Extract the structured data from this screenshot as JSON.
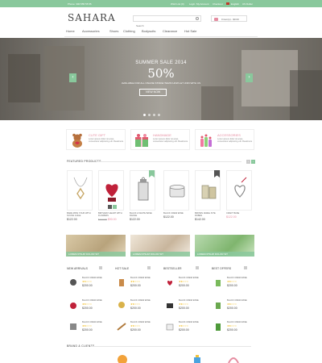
{
  "topbar": {
    "phone": "Phone: 300 555 55 55",
    "links": [
      "Wish List (0)",
      "Login",
      "My Account",
      "Checkout",
      "English",
      "US Dollar"
    ]
  },
  "header": {
    "logo": "SAHARA",
    "search_placeholder": "Search",
    "cart_label": "0 item(s) - $0.00"
  },
  "nav": [
    "Home",
    "Accessories",
    "Shoes",
    "Clothing",
    "Bodysuits",
    "Clearance",
    "Hot Sale"
  ],
  "hero": {
    "title": "SUMMER SALE 2014",
    "percent": "50%",
    "subtitle": "AVAILABLE FOR ALL ONLINE STORE ITEMS! HOW LET JOIN WITH US",
    "button": "VIEW NOW",
    "prev": "‹",
    "next": "›"
  },
  "features": [
    {
      "title": "CUTE GIFT",
      "desc": "Lorem ipsum dolor sit amet, consectetur adipiscing elit. Readmore",
      "color": "#e58ca0"
    },
    {
      "title": "HANDMADE",
      "desc": "Lorem ipsum dolor sit amet, consectetur adipiscing elit. Readmore",
      "color": "#e58ca0"
    },
    {
      "title": "ACCESSORIES",
      "desc": "Lorem ipsum dolor sit amet, consectetur adipiscing elit. Readmore",
      "color": "#e58ca0"
    }
  ],
  "featured": {
    "title": "FEATURED PRODUCTS",
    "products": [
      {
        "name": "BARE MISS YOUR WITH SOUVE JAIGE",
        "price": "$122.00",
        "old": ""
      },
      {
        "name": "BIRTHDAY HEART WITH FLOWERS",
        "price": "$90.00",
        "old": "$122.00"
      },
      {
        "name": "BLACK & WHITE BASE RANGE",
        "price": "$122.00",
        "old": ""
      },
      {
        "name": "BLACK CREW ESSE",
        "price": "$122.00",
        "old": ""
      },
      {
        "name": "BROWN JEWEL SITE ROBES",
        "price": "$142.00",
        "old": ""
      },
      {
        "name": "CRAFT BASE",
        "price": "$122.00",
        "old": ""
      }
    ]
  },
  "banners": [
    "LOREM IPSUM DOLOR SIT",
    "LOREM IPSUM DOLOR SIT",
    "LOREM IPSUM DOLOR SIT"
  ],
  "lists": [
    {
      "title": "NEW ARRIVALS",
      "items": [
        {
          "name": "BLACK CREW ESSE",
          "price": "$200.00"
        },
        {
          "name": "BLACK CREW ESSE",
          "price": "$200.00"
        },
        {
          "name": "BLACK CREW ESSE",
          "price": "$200.00"
        }
      ]
    },
    {
      "title": "HOT SALE",
      "items": [
        {
          "name": "BLACK CREW ESSE",
          "price": "$200.00"
        },
        {
          "name": "BLACK CREW ESSE",
          "price": "$200.00"
        },
        {
          "name": "BLACK CREW ESSE",
          "price": "$200.00"
        }
      ]
    },
    {
      "title": "BESTSELLER",
      "items": [
        {
          "name": "BLACK CREW ESSE",
          "price": "$200.00"
        },
        {
          "name": "BLACK CREW ESSE",
          "price": "$200.00"
        },
        {
          "name": "BLACK CREW ESSE",
          "price": "$200.00"
        }
      ]
    },
    {
      "title": "BEST OFFERS",
      "items": [
        {
          "name": "BLACK CREW ESSE",
          "price": "$200.00"
        },
        {
          "name": "BLACK CREW ESSE",
          "price": "$200.00"
        },
        {
          "name": "BLACK CREW ESSE",
          "price": "$200.00"
        }
      ]
    }
  ],
  "brands": {
    "title": "BRAND & CLIENTS"
  },
  "colors": {
    "accent": "#89c89c",
    "pink": "#e58ca0",
    "text": "#555555"
  }
}
